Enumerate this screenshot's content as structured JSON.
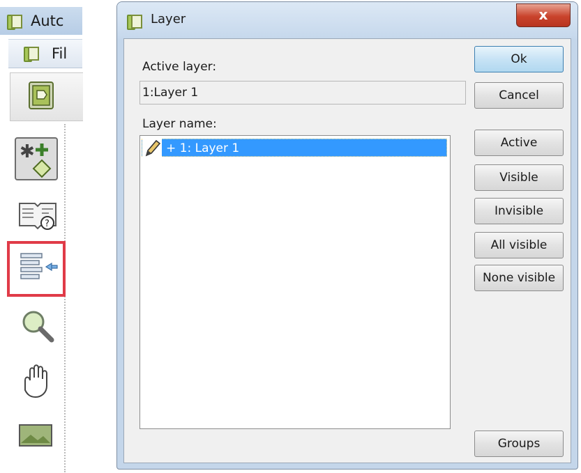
{
  "background_app": {
    "title_fragment": "Autc",
    "menu_fragment": "Fil"
  },
  "toolbar": {
    "tools": [
      {
        "icon": "open-file-icon"
      },
      {
        "icon": "new-layer-icon"
      },
      {
        "icon": "help-book-icon"
      },
      {
        "icon": "layers-icon",
        "selected": true
      },
      {
        "icon": "zoom-icon"
      },
      {
        "icon": "pan-hand-icon"
      },
      {
        "icon": "image-icon"
      }
    ],
    "highlight_color": "#e03b48"
  },
  "dialog": {
    "title": "Layer",
    "close_label": "x",
    "active_layer_label": "Active layer:",
    "active_layer_value": "1:Layer 1",
    "layer_name_label": "Layer name:",
    "layers": [
      {
        "prefix": "+",
        "label": "1: Layer 1",
        "selected": true,
        "icon": "pencil-icon"
      }
    ],
    "buttons": {
      "ok": "Ok",
      "cancel": "Cancel",
      "active": "Active",
      "visible": "Visible",
      "invisible": "Invisible",
      "all_visible": "All visible",
      "none_visible": "None visible",
      "groups": "Groups"
    },
    "colors": {
      "selection": "#3399ff",
      "close_button": "#c9432c",
      "frame": "#c4d6ea"
    }
  }
}
